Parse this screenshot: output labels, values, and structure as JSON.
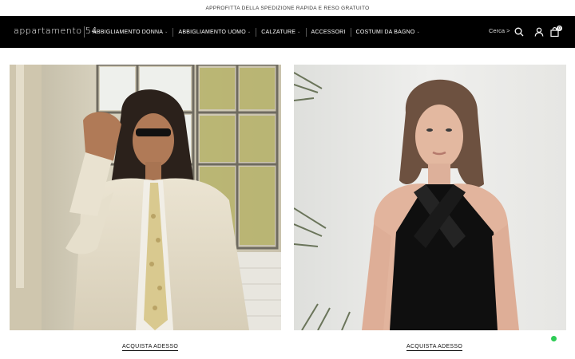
{
  "announcement": "APPROFITTA DELLA SPEDIZIONE RAPIDA E RESO GRATUITO",
  "header": {
    "logo": "appartamento 54",
    "nav": [
      {
        "label": "ABBIGLIAMENTO DONNA",
        "has_dropdown": true
      },
      {
        "label": "ABBIGLIAMENTO UOMO",
        "has_dropdown": true
      },
      {
        "label": "CALZATURE",
        "has_dropdown": true
      },
      {
        "label": "ACCESSORI",
        "has_dropdown": false
      },
      {
        "label": "COSTUMI DA BAGNO",
        "has_dropdown": true
      }
    ],
    "search_label": "Cerca >",
    "cart_count": "0",
    "icons": [
      "search-icon",
      "account-icon",
      "cart-icon"
    ]
  },
  "hero": [
    {
      "cta": "ACQUISTA ADESSO",
      "image": "man-in-cream-suit-sunglasses"
    },
    {
      "cta": "ACQUISTA ADESSO",
      "image": "woman-in-black-halter-top"
    }
  ],
  "colors": {
    "header_bg": "#000000",
    "chat_dot": "#2ecc55"
  }
}
